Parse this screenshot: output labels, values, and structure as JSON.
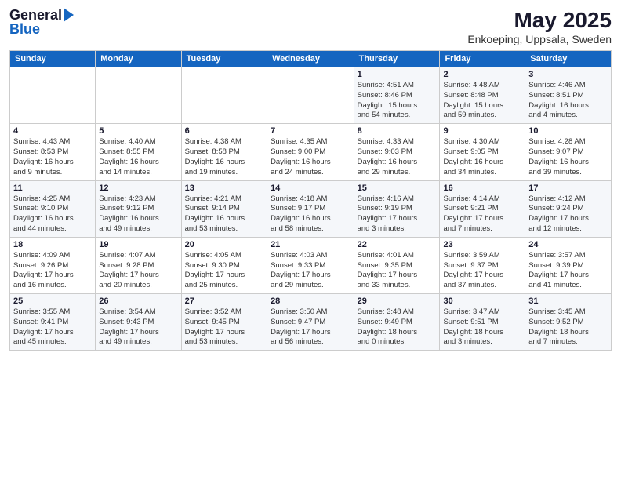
{
  "header": {
    "logo_general": "General",
    "logo_blue": "Blue",
    "main_title": "May 2025",
    "subtitle": "Enkoeping, Uppsala, Sweden"
  },
  "calendar": {
    "days_of_week": [
      "Sunday",
      "Monday",
      "Tuesday",
      "Wednesday",
      "Thursday",
      "Friday",
      "Saturday"
    ],
    "weeks": [
      [
        {
          "day": "",
          "info": ""
        },
        {
          "day": "",
          "info": ""
        },
        {
          "day": "",
          "info": ""
        },
        {
          "day": "",
          "info": ""
        },
        {
          "day": "1",
          "info": "Sunrise: 4:51 AM\nSunset: 8:46 PM\nDaylight: 15 hours\nand 54 minutes."
        },
        {
          "day": "2",
          "info": "Sunrise: 4:48 AM\nSunset: 8:48 PM\nDaylight: 15 hours\nand 59 minutes."
        },
        {
          "day": "3",
          "info": "Sunrise: 4:46 AM\nSunset: 8:51 PM\nDaylight: 16 hours\nand 4 minutes."
        }
      ],
      [
        {
          "day": "4",
          "info": "Sunrise: 4:43 AM\nSunset: 8:53 PM\nDaylight: 16 hours\nand 9 minutes."
        },
        {
          "day": "5",
          "info": "Sunrise: 4:40 AM\nSunset: 8:55 PM\nDaylight: 16 hours\nand 14 minutes."
        },
        {
          "day": "6",
          "info": "Sunrise: 4:38 AM\nSunset: 8:58 PM\nDaylight: 16 hours\nand 19 minutes."
        },
        {
          "day": "7",
          "info": "Sunrise: 4:35 AM\nSunset: 9:00 PM\nDaylight: 16 hours\nand 24 minutes."
        },
        {
          "day": "8",
          "info": "Sunrise: 4:33 AM\nSunset: 9:03 PM\nDaylight: 16 hours\nand 29 minutes."
        },
        {
          "day": "9",
          "info": "Sunrise: 4:30 AM\nSunset: 9:05 PM\nDaylight: 16 hours\nand 34 minutes."
        },
        {
          "day": "10",
          "info": "Sunrise: 4:28 AM\nSunset: 9:07 PM\nDaylight: 16 hours\nand 39 minutes."
        }
      ],
      [
        {
          "day": "11",
          "info": "Sunrise: 4:25 AM\nSunset: 9:10 PM\nDaylight: 16 hours\nand 44 minutes."
        },
        {
          "day": "12",
          "info": "Sunrise: 4:23 AM\nSunset: 9:12 PM\nDaylight: 16 hours\nand 49 minutes."
        },
        {
          "day": "13",
          "info": "Sunrise: 4:21 AM\nSunset: 9:14 PM\nDaylight: 16 hours\nand 53 minutes."
        },
        {
          "day": "14",
          "info": "Sunrise: 4:18 AM\nSunset: 9:17 PM\nDaylight: 16 hours\nand 58 minutes."
        },
        {
          "day": "15",
          "info": "Sunrise: 4:16 AM\nSunset: 9:19 PM\nDaylight: 17 hours\nand 3 minutes."
        },
        {
          "day": "16",
          "info": "Sunrise: 4:14 AM\nSunset: 9:21 PM\nDaylight: 17 hours\nand 7 minutes."
        },
        {
          "day": "17",
          "info": "Sunrise: 4:12 AM\nSunset: 9:24 PM\nDaylight: 17 hours\nand 12 minutes."
        }
      ],
      [
        {
          "day": "18",
          "info": "Sunrise: 4:09 AM\nSunset: 9:26 PM\nDaylight: 17 hours\nand 16 minutes."
        },
        {
          "day": "19",
          "info": "Sunrise: 4:07 AM\nSunset: 9:28 PM\nDaylight: 17 hours\nand 20 minutes."
        },
        {
          "day": "20",
          "info": "Sunrise: 4:05 AM\nSunset: 9:30 PM\nDaylight: 17 hours\nand 25 minutes."
        },
        {
          "day": "21",
          "info": "Sunrise: 4:03 AM\nSunset: 9:33 PM\nDaylight: 17 hours\nand 29 minutes."
        },
        {
          "day": "22",
          "info": "Sunrise: 4:01 AM\nSunset: 9:35 PM\nDaylight: 17 hours\nand 33 minutes."
        },
        {
          "day": "23",
          "info": "Sunrise: 3:59 AM\nSunset: 9:37 PM\nDaylight: 17 hours\nand 37 minutes."
        },
        {
          "day": "24",
          "info": "Sunrise: 3:57 AM\nSunset: 9:39 PM\nDaylight: 17 hours\nand 41 minutes."
        }
      ],
      [
        {
          "day": "25",
          "info": "Sunrise: 3:55 AM\nSunset: 9:41 PM\nDaylight: 17 hours\nand 45 minutes."
        },
        {
          "day": "26",
          "info": "Sunrise: 3:54 AM\nSunset: 9:43 PM\nDaylight: 17 hours\nand 49 minutes."
        },
        {
          "day": "27",
          "info": "Sunrise: 3:52 AM\nSunset: 9:45 PM\nDaylight: 17 hours\nand 53 minutes."
        },
        {
          "day": "28",
          "info": "Sunrise: 3:50 AM\nSunset: 9:47 PM\nDaylight: 17 hours\nand 56 minutes."
        },
        {
          "day": "29",
          "info": "Sunrise: 3:48 AM\nSunset: 9:49 PM\nDaylight: 18 hours\nand 0 minutes."
        },
        {
          "day": "30",
          "info": "Sunrise: 3:47 AM\nSunset: 9:51 PM\nDaylight: 18 hours\nand 3 minutes."
        },
        {
          "day": "31",
          "info": "Sunrise: 3:45 AM\nSunset: 9:52 PM\nDaylight: 18 hours\nand 7 minutes."
        }
      ]
    ]
  }
}
